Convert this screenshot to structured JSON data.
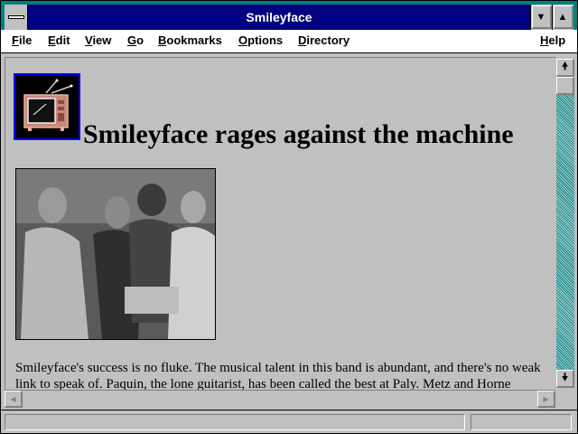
{
  "window": {
    "title": "Smileyface"
  },
  "menubar": {
    "items": [
      {
        "label": "File",
        "accel": "F",
        "rest": "ile"
      },
      {
        "label": "Edit",
        "accel": "E",
        "rest": "dit"
      },
      {
        "label": "View",
        "accel": "V",
        "rest": "iew"
      },
      {
        "label": "Go",
        "accel": "G",
        "rest": "o"
      },
      {
        "label": "Bookmarks",
        "accel": "B",
        "rest": "ookmarks"
      },
      {
        "label": "Options",
        "accel": "O",
        "rest": "ptions"
      },
      {
        "label": "Directory",
        "accel": "D",
        "rest": "irectory"
      },
      {
        "label": "Help",
        "accel": "H",
        "rest": "elp"
      }
    ]
  },
  "page": {
    "headline": "Smileyface rages against the machine",
    "tv_icon": "television-icon",
    "photo": "band-photo",
    "paragraph": "Smileyface's success is no fluke. The musical talent in this band is abundant, and there's no weak link to speak of. Paquin, the lone guitarist, has been called the best at Paly. Metz and Horne"
  },
  "scrollbar": {
    "up_icon": "arrow-up-icon",
    "down_icon": "arrow-down-icon",
    "left_icon": "arrow-left-icon",
    "right_icon": "arrow-right-icon"
  },
  "statusbar": {
    "text": ""
  },
  "colors": {
    "titlebar": "#000080",
    "frame": "#008080",
    "background": "#c0c0c0",
    "icon_border": "#0000ff"
  }
}
